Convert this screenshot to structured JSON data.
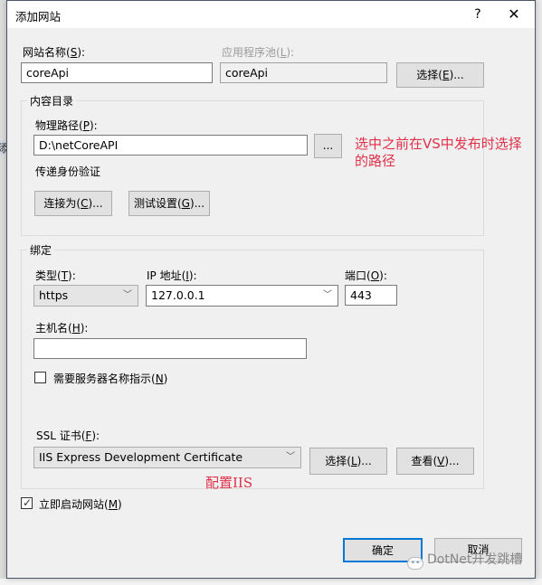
{
  "background": {
    "left_window_fragment": "添"
  },
  "window": {
    "title": "添加网站",
    "help_label": "?",
    "close_label": "✕"
  },
  "site_name": {
    "label": "网站名称(",
    "accel": "S",
    "label_tail": "):",
    "value": "coreApi"
  },
  "app_pool": {
    "label": "应用程序池(",
    "accel": "L",
    "label_tail": "):",
    "value": "coreApi",
    "select_button": {
      "label": "选择(",
      "accel": "E",
      "tail": ")..."
    }
  },
  "content_directory": {
    "group_title": "内容目录",
    "physical_path": {
      "label": "物理路径(",
      "accel": "P",
      "label_tail": "):",
      "value": "D:\\netCoreAPI",
      "browse_label": "..."
    },
    "pass_through_auth_label": "传递身份验证",
    "connect_as_button": {
      "label": "连接为(",
      "accel": "C",
      "tail": ")..."
    },
    "test_settings_button": {
      "label": "测试设置(",
      "accel": "G",
      "tail": ")..."
    }
  },
  "binding": {
    "group_title": "绑定",
    "type": {
      "label": "类型(",
      "accel": "T",
      "label_tail": "):",
      "value": "https"
    },
    "ip_address": {
      "label": "IP 地址(",
      "accel": "I",
      "label_tail": "):",
      "value": "127.0.0.1"
    },
    "port": {
      "label": "端口(",
      "accel": "O",
      "label_tail": "):",
      "value": "443"
    },
    "host_name": {
      "label": "主机名(",
      "accel": "H",
      "label_tail": "):",
      "value": ""
    },
    "sni": {
      "label": "需要服务器名称指示(",
      "accel": "N",
      "label_tail": ")",
      "checked": false
    },
    "ssl_cert": {
      "label": "SSL 证书(",
      "accel": "F",
      "label_tail": "):",
      "value": "IIS Express Development Certificate",
      "select_button": {
        "label": "选择(",
        "accel": "L",
        "tail": ")..."
      },
      "view_button": {
        "label": "查看(",
        "accel": "V",
        "tail": ")..."
      }
    }
  },
  "start_immediately": {
    "label": "立即启动网站(",
    "accel": "M",
    "label_tail": ")",
    "checked": true
  },
  "footer": {
    "ok_label": "确定",
    "cancel_label": "取消"
  },
  "annotations": {
    "path_note_line1": "选中之前在VS中发布时选择",
    "path_note_line2": "的路径",
    "iis_note": "配置IIS",
    "color": "#e0304a"
  },
  "watermark": {
    "text": "DotNet开发跳槽"
  },
  "colors": {
    "dialog_bg": "#f0f0f0",
    "titlebar_bg": "#ffffff",
    "primary_border": "#0078d7",
    "button_bg": "#e1e1e1"
  }
}
